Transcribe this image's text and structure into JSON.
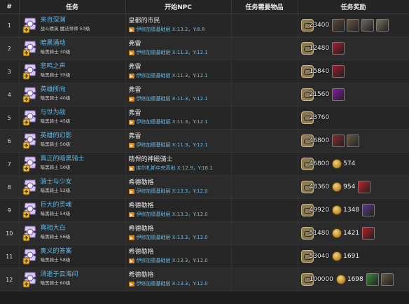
{
  "headers": {
    "num": "#",
    "quest": "任务",
    "npc": "开始NPC",
    "items": "任务需要物品",
    "reward": "任务奖励"
  },
  "rows": [
    {
      "num": "1",
      "name": "来自深渊",
      "sub": "战斗精英 魔法导师 50级",
      "npc": "皇都的市民",
      "loc": "伊修加德基础层 X:13.2，Y:8.8",
      "exp": "23400",
      "gil": "",
      "items": [
        "#5a4a3a",
        "#6a5a45",
        "#6d6660",
        "#7a7060"
      ]
    },
    {
      "num": "2",
      "name": "暗黑涌动",
      "sub": "暗黑骑士 30级",
      "npc": "弗雷",
      "loc": "伊修加德基础层 X:11.3，Y:12.1",
      "exp": "12480",
      "gil": "",
      "items": [
        "#b0182a"
      ]
    },
    {
      "num": "3",
      "name": "悲鸣之声",
      "sub": "暗黑骑士 35级",
      "npc": "弗雷",
      "loc": "伊修加德基础层 X:11.3，Y:12.1",
      "exp": "15840",
      "gil": "",
      "items": [
        "#a0162a"
      ]
    },
    {
      "num": "4",
      "name": "英雄所向",
      "sub": "暗黑骑士 40级",
      "npc": "弗雷",
      "loc": "伊修加德基础层 X:11.3，Y:12.1",
      "exp": "21560",
      "gil": "",
      "items": [
        "#8a1aa8"
      ]
    },
    {
      "num": "5",
      "name": "与世为敌",
      "sub": "暗黑骑士 45级",
      "npc": "弗雷",
      "loc": "伊修加德基础层 X:11.3，Y:12.1",
      "exp": "23760",
      "gil": "",
      "items": []
    },
    {
      "num": "6",
      "name": "英雄的幻影",
      "sub": "暗黑骑士 50级",
      "npc": "弗雷",
      "loc": "伊修加德基础层 X:11.3，Y:12.1",
      "exp": "46800",
      "gil": "",
      "items": [
        "#8a2a2a",
        "#6a5a45"
      ]
    },
    {
      "num": "7",
      "name": "真正的暗黑骑士",
      "sub": "暗黑骑士 50级",
      "npc": "精悍的神殿骑士",
      "loc": "库尔札斯中央高地 X:12.9，Y:16.1",
      "exp": "46800",
      "gil": "574",
      "items": []
    },
    {
      "num": "8",
      "name": "骑士与少女",
      "sub": "暗黑骑士 52级",
      "npc": "希德勒格",
      "loc": "伊修加德基础层 X:13.3，Y:12.0",
      "exp": "48360",
      "gil": "954",
      "items": [
        "#c0202a"
      ]
    },
    {
      "num": "9",
      "name": "巨大的灵魂",
      "sub": "暗黑骑士 54级",
      "npc": "希德勒格",
      "loc": "伊修加德基础层 X:13.3，Y:12.0",
      "exp": "49920",
      "gil": "1348",
      "items": [
        "#5a3a8a"
      ]
    },
    {
      "num": "10",
      "name": "真相大白",
      "sub": "暗黑骑士 56级",
      "npc": "希德勒格",
      "loc": "伊修加德基础层 X:13.3，Y:12.0",
      "exp": "51480",
      "gil": "1421",
      "items": [
        "#b81a20"
      ]
    },
    {
      "num": "11",
      "name": "奥义的答案",
      "sub": "暗黑骑士 58级",
      "npc": "希德勒格",
      "loc": "伊修加德基础层 X:13.3，Y:12.0",
      "exp": "53040",
      "gil": "1691",
      "items": []
    },
    {
      "num": "12",
      "name": "消逝于云海间",
      "sub": "暗黑骑士 60级",
      "npc": "希德勒格",
      "loc": "伊修加德基础层 X:13.3，Y:12.0",
      "exp": "100000",
      "gil": "1698",
      "items": [
        "#3a8a3a",
        "#6a5a45"
      ]
    }
  ]
}
